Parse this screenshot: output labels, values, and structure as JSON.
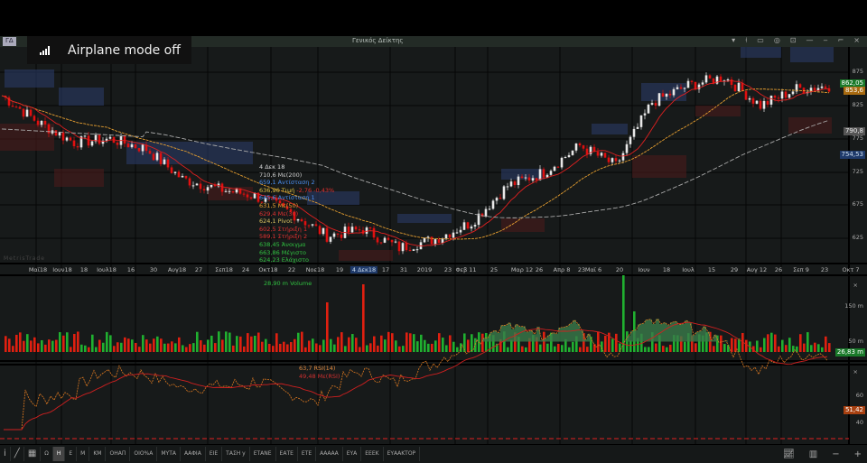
{
  "window": {
    "left_tag": "ΓΔ",
    "title": "Γενικός Δείκτης",
    "controls": [
      "▾",
      "⍿",
      "▭",
      "◎",
      "⊡",
      "—",
      "‒",
      "⌐",
      "×"
    ]
  },
  "notification": {
    "text": "Airplane mode off",
    "icon": "signal-bars-icon"
  },
  "watermark": "MetrisTrade",
  "legend": {
    "date": "4 Δεκ 18",
    "ma200": "710,6 Mε(200)",
    "r2": "659,1 Αντίσταση 2",
    "price": "636,96 Τιμή",
    "change": "-2,76 -0,43%",
    "r1": "645,6 Αντίσταση 1",
    "ma50": "631,5 Mε(50)",
    "ma30": "629,4 Mε(30)",
    "pivot": "624,1 Pivot",
    "s1": "602,5 Στήριξη 1",
    "s2": "589,1 Στήριξη 2",
    "open": "638,45 Άνοιγμα",
    "high": "663,86 Μέγιστο",
    "low": "624,23 Ελάχιστο"
  },
  "price_axis": {
    "ticks": [
      "875",
      "825",
      "775",
      "725",
      "675",
      "625"
    ],
    "labels": {
      "last": "862,05",
      "ma30": "853,6",
      "ma200": "790,8",
      "cursor": "754,53"
    }
  },
  "date_axis": [
    "Μαϊ18",
    "Ιουν18",
    "18",
    "Ιουλ18",
    "16",
    "30",
    "Αυγ18",
    "27",
    "Σεπ18",
    "24",
    "Οκτ18",
    "22",
    "Νοε18",
    "19",
    "4 Δεκ18",
    "17",
    "31",
    "2019",
    "23",
    "Φεβ 11",
    "25",
    "Μαρ 12",
    "26",
    "Απρ 8",
    "23",
    "Μαϊ 6",
    "20",
    "Ιουν",
    "18",
    "Ιουλ",
    "15",
    "29",
    "Αυγ 12",
    "26",
    "Σεπ 9",
    "23",
    "Οκτ 7"
  ],
  "volume": {
    "legend": "28,90 m Volume",
    "ticks": [
      "150 m",
      "50 m"
    ],
    "last": "26,83 m",
    "close": "×"
  },
  "rsi": {
    "legend": "63,7 RSI(14)",
    "signal_legend": "49,48 Mε(RSI)",
    "ticks": [
      "60",
      "40"
    ],
    "last": "51,42",
    "close": "×"
  },
  "toolbar": {
    "items": [
      "Ω",
      "Η",
      "Ε",
      "Μ",
      "ΚΜ",
      "ΟΗΑΠ",
      "ΟΙΟ%Α",
      "ΜΥΤΑ",
      "ΑΑΦΙΑ",
      "ΕΙΕ",
      "ΤΑΣΗ y",
      "ΕΤΑΝΕ",
      "ΕΑΤΕ",
      "ΕΤΕ",
      "ΑΑΑΑΑ",
      "ΕΥΑ",
      "ΕΕΕΚ",
      "ΕΥΑΑΚΤΟΡ"
    ],
    "active": "Η"
  },
  "colors": {
    "up": "#e8e8e8",
    "down": "#e01010",
    "ma30": "#e02020",
    "ma50": "#e8a030",
    "ma200": "#aaaaaa",
    "vol_up": "#20b030",
    "vol_down": "#e02010",
    "rsi": "#e07a20",
    "resistance_zone": "#2a3a66",
    "support_zone": "#4a1a1a"
  },
  "chart_data": {
    "type": "candlestick",
    "price_range": [
      600,
      890
    ],
    "approx_closes": [
      840,
      800,
      770,
      775,
      760,
      715,
      700,
      690,
      665,
      630,
      640,
      612,
      625,
      650,
      705,
      725,
      765,
      735,
      830,
      855,
      868,
      825,
      850,
      855
    ]
  }
}
